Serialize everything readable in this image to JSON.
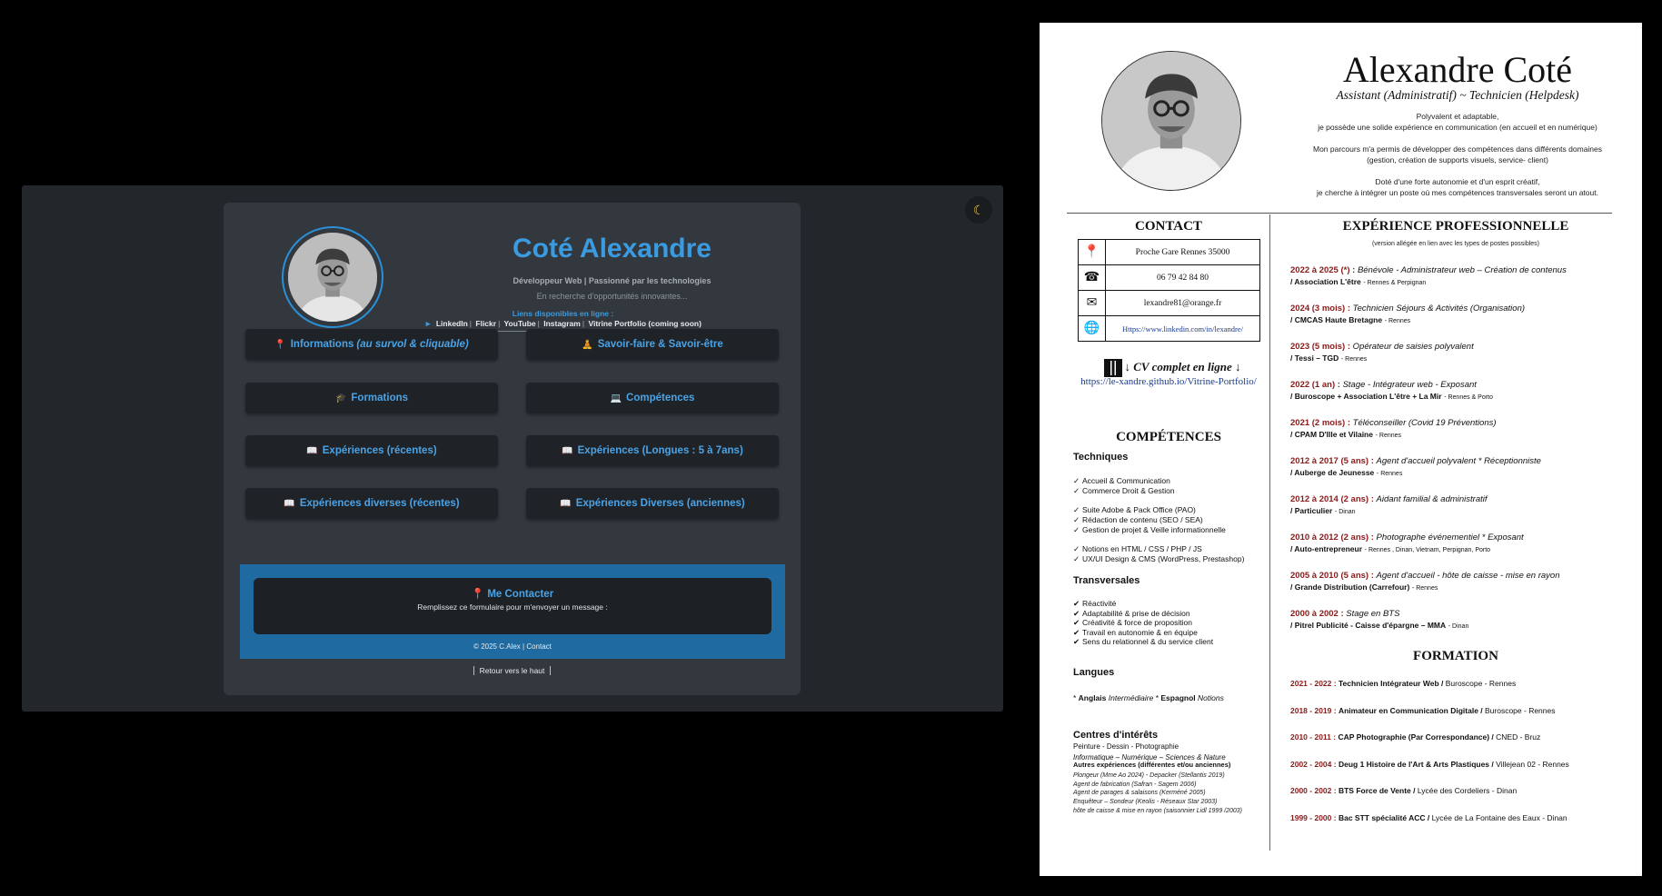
{
  "site": {
    "theme_toggle_icon": "moon-icon",
    "title": "Coté Alexandre",
    "subtitle": "Développeur Web | Passionné par les technologies",
    "tagline": "En recherche d'opportunités innovantes...",
    "links_heading": "Liens disponibles en ligne :",
    "links": [
      "LinkedIn",
      "Flickr",
      "YouTube",
      "Instagram",
      "Vitrine Portfolio (coming soon)"
    ],
    "menu": [
      {
        "icon": "📍",
        "label": "Informations ",
        "label_italic": "(au survol & cliquable)"
      },
      {
        "icon": "🧘",
        "label": "Savoir-faire & Savoir-être"
      },
      {
        "icon": "🎓",
        "label": "Formations"
      },
      {
        "icon": "💻",
        "label": "Compétences"
      },
      {
        "icon": "📖",
        "label": "Expériences (récentes)"
      },
      {
        "icon": "📖",
        "label": "Expériences (Longues : 5 à 7ans)"
      },
      {
        "icon": "📖",
        "label": "Expériences diverses (récentes)"
      },
      {
        "icon": "📖",
        "label": "Expériences Diverses (anciennes)"
      }
    ],
    "contact_icon": "📍",
    "contact_title": "Me Contacter",
    "contact_desc": "Remplissez ce formulaire pour m'envoyer un message :",
    "footer": "© 2025 C.Alex | Contact",
    "back_to_top": "Retour vers le haut",
    "colors": {
      "accent": "#3b9be0",
      "band": "#1f6aa0",
      "bg": "#23272b",
      "card": "#32383e"
    }
  },
  "cv": {
    "name": "Alexandre Coté",
    "role": "Assistant (Administratif) ~ Technicien (Helpdesk)",
    "intro": [
      [
        "Polyvalent et adaptable,",
        "je possède une solide expérience en communication (en accueil et en numérique)"
      ],
      [
        "Mon parcours m'a permis de développer des compétences dans différents domaines",
        "(gestion, création de supports visuels, service- client)"
      ],
      [
        "Doté d'une forte autonomie et d'un esprit créatif,",
        "je cherche à intégrer un poste où mes compétences transversales seront un atout."
      ]
    ],
    "contact_heading": "CONTACT",
    "contact": [
      {
        "icon": "map-pin-icon",
        "glyph": "📍",
        "value": "Proche Gare Rennes 35000"
      },
      {
        "icon": "phone-icon",
        "glyph": "☎",
        "value": "06 79 42 84 80"
      },
      {
        "icon": "mail-icon",
        "glyph": "✉",
        "value": "lexandre81@orange.fr"
      },
      {
        "icon": "globe-icon",
        "glyph": "🌐",
        "value": "Https://www.linkedin.com/in/lexandre/"
      }
    ],
    "full_cv_label": "↓ CV complet en ligne ↓",
    "full_cv_url": "https://le-xandre.github.io/Vitrine-Portfolio/",
    "skills_heading": "COMPÉTENCES",
    "technical_heading": "Techniques",
    "technical": [
      [
        "Accueil & Communication",
        "Commerce Droit & Gestion"
      ],
      [
        "Suite Adobe & Pack Office (PAO)",
        "Rédaction de contenu (SEO / SEA)",
        "Gestion de projet & Veille informationnelle"
      ],
      [
        "Notions en HTML / CSS / PHP / JS",
        "UX/UI Design & CMS (WordPress, Prestashop)"
      ]
    ],
    "transversal_heading": "Transversales",
    "transversal": [
      "Réactivité",
      "Adaptabilité & prise de décision",
      "Créativité & force de proposition",
      "Travail en autonomie & en équipe",
      "Sens du relationnel & du service client"
    ],
    "languages_heading": "Langues",
    "languages": [
      {
        "lang": "Anglais",
        "level": "Intermédiaire"
      },
      {
        "lang": "Espagnol",
        "level": "Notions"
      }
    ],
    "interests_heading": "Centres d'intérêts",
    "interests_line1": "Peinture - Dessin - Photographie",
    "interests_line2": "Informatique – Numérique – Sciences & Nature",
    "other_heading": "Autres expériences (différentes et/ou anciennes)",
    "other": [
      "Plongeur (Mme Ao 2024) - Depacker (Stellantis 2019)",
      "Agent de fabrication (Safran - Sagem 2006)",
      "Agent de parages & salaisons (Kerméné 2005)",
      "Enquêteur – Sondeur (Keolis - Réseaux Star 2003)",
      "hôte de caisse & mise en rayon (saisonnier Lidl 1999 /2003)"
    ],
    "experience_heading": "EXPÉRIENCE PROFESSIONNELLE",
    "experience_sub": "(version allégée en lien avec les types de postes possibles)",
    "experience": [
      {
        "date": "2022 à 2025 (*) :",
        "role": "Bénévole - Administrateur web – Création de contenus",
        "org": "/ Association L'être",
        "place": "- Rennes & Perpignan"
      },
      {
        "date": "2024 (3 mois) :",
        "role": "Technicien Séjours & Activités (Organisation)",
        "org": "/ CMCAS Haute Bretagne",
        "place": "- Rennes"
      },
      {
        "date": "2023 (5 mois) :",
        "role": "Opérateur de saisies polyvalent",
        "org": "/ Tessi – TGD",
        "place": "- Rennes"
      },
      {
        "date": "2022 (1 an) :",
        "role": "Stage - Intégrateur web - Exposant",
        "org": "/ Buroscope + Association L'être + La Mir",
        "place": "- Rennes & Porto"
      },
      {
        "date": "2021 (2 mois) :",
        "role": "Téléconseiller (Covid 19 Préventions)",
        "org": "/ CPAM D'Ille et Vilaine",
        "place": "- Rennes"
      },
      {
        "date": "2012 à 2017 (5 ans) :",
        "role": "Agent d'accueil polyvalent * Réceptionniste",
        "org": "/ Auberge de Jeunesse",
        "place": "- Rennes"
      },
      {
        "date": "2012 à 2014 (2 ans) :",
        "role": "Aidant familial & administratif",
        "org": "/ Particulier",
        "place": "- Dinan"
      },
      {
        "date": "2010 à 2012 (2 ans) :",
        "role": "Photographe événementiel * Exposant",
        "org": "/ Auto-entrepreneur",
        "place": "- Rennes , Dinan, Vietnam, Perpignan, Porto"
      },
      {
        "date": "2005 à 2010 (5 ans) :",
        "role": "Agent d'accueil - hôte de caisse - mise en rayon",
        "org": "/ Grande Distribution (Carrefour)",
        "place": "- Rennes"
      },
      {
        "date": "2000 à 2002 :",
        "role": "Stage en BTS",
        "org": "/ Pitrel Publicité - Caisse d'épargne – MMA",
        "place": "- Dinan"
      }
    ],
    "education_heading": "FORMATION",
    "education": [
      {
        "date": "2021 - 2022 :",
        "title": "Technicien Intégrateur Web /",
        "place": " Buroscope - Rennes"
      },
      {
        "date": "2018 - 2019 :",
        "title": "Animateur en Communication Digitale /",
        "place": " Buroscope - Rennes"
      },
      {
        "date": "2010 - 2011 :",
        "title": "CAP Photographie (Par Correspondance) /",
        "place": " CNED - Bruz"
      },
      {
        "date": "2002 - 2004 :",
        "title": "Deug 1 Histoire de l'Art & Arts Plastiques /",
        "place": " Villejean 02 - Rennes"
      },
      {
        "date": "2000 - 2002 :",
        "title": "BTS Force de Vente /",
        "place": " Lycée des Cordeliers - Dinan"
      },
      {
        "date": "1999 - 2000 :",
        "title": "Bac STT spécialité ACC /",
        "place": " Lycée de La Fontaine des Eaux - Dinan"
      }
    ],
    "colors": {
      "date": "#8b1a1a",
      "link": "#1a3a8c"
    }
  }
}
